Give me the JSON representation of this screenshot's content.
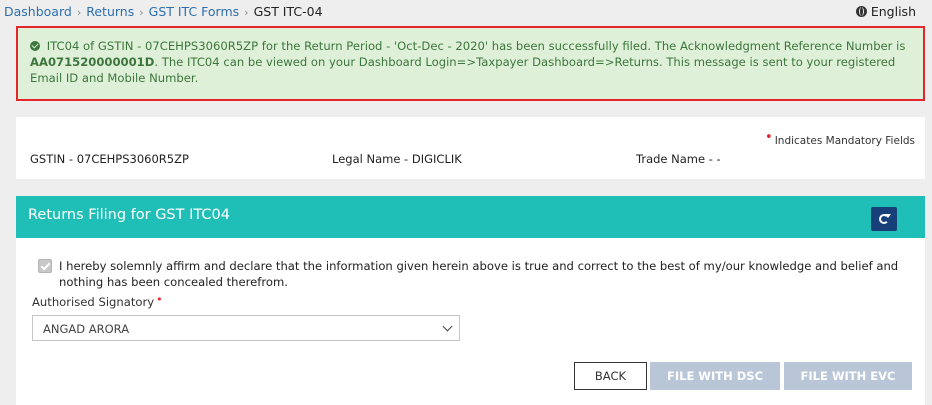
{
  "breadcrumb": {
    "items": [
      "Dashboard",
      "Returns",
      "GST ITC Forms"
    ],
    "current": "GST ITC-04"
  },
  "language": "English",
  "alert": {
    "text_before": "ITC04 of GSTIN - 07CEHPS3060R5ZP for the Return Period - 'Oct-Dec - 2020' has been successfully filed. The Acknowledgment Reference Number is ",
    "arn": "AA071520000001D",
    "text_after": ". The ITC04 can be viewed on your Dashboard Login=>Taxpayer Dashboard=>Returns. This message is sent to your registered Email ID and Mobile Number."
  },
  "taxpayer": {
    "mandatory_note": "Indicates Mandatory Fields",
    "gstin": "GSTIN - 07CEHPS3060R5ZP",
    "legal_name": "Legal Name - DIGICLIK",
    "trade_name": "Trade Name - -"
  },
  "filing": {
    "title": "Returns Filing for GST ITC04",
    "declaration": "I hereby solemnly affirm and declare that the information given herein above is true and correct to the best of my/our knowledge and belief and nothing has been concealed therefrom.",
    "declaration_checked": true,
    "signatory_label": "Authorised Signatory",
    "signatory_value": "ANGAD ARORA",
    "buttons": {
      "back": "BACK",
      "file_dsc": "FILE WITH DSC",
      "file_evc": "FILE WITH EVC"
    }
  },
  "colors": {
    "alert_border": "#e3262b",
    "alert_bg": "#dff0d8",
    "panel_header": "#1fbfb8",
    "refresh_button": "#17407a",
    "disabled_button": "#b9c6d8"
  },
  "icons": {
    "language": "globe-icon",
    "success": "check-circle-icon",
    "refresh": "refresh-icon",
    "dropdown": "chevron-down-icon"
  }
}
